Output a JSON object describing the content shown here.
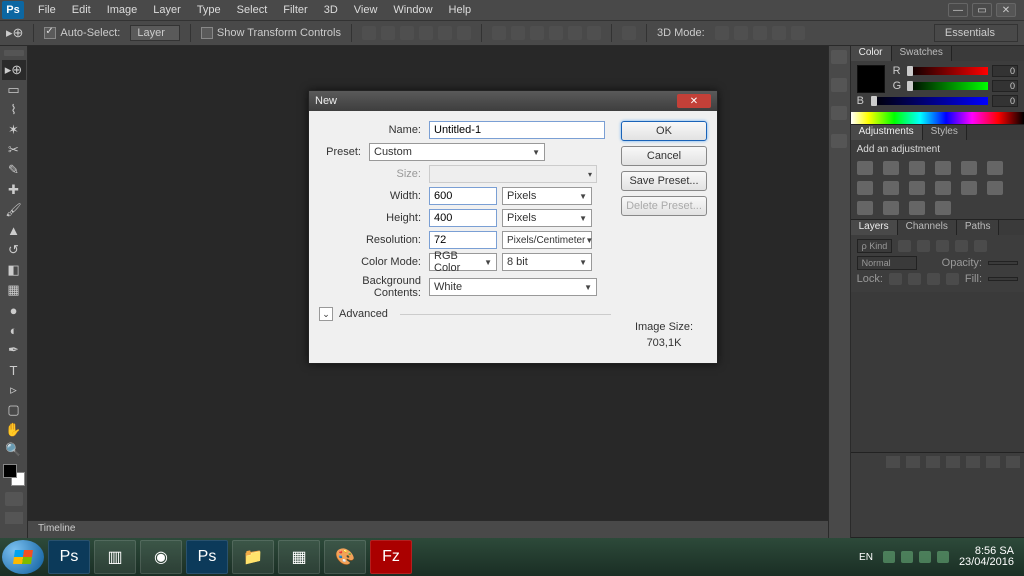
{
  "menubar": {
    "logo": "Ps",
    "items": [
      "File",
      "Edit",
      "Image",
      "Layer",
      "Type",
      "Select",
      "Filter",
      "3D",
      "View",
      "Window",
      "Help"
    ]
  },
  "optionsbar": {
    "auto_select": "Auto-Select:",
    "auto_select_target": "Layer",
    "show_transform": "Show Transform Controls",
    "mode_3d": "3D Mode:",
    "workspace": "Essentials"
  },
  "dialog": {
    "title": "New",
    "labels": {
      "name": "Name:",
      "preset": "Preset:",
      "size": "Size:",
      "width": "Width:",
      "height": "Height:",
      "resolution": "Resolution:",
      "color_mode": "Color Mode:",
      "bg_contents": "Background Contents:",
      "advanced": "Advanced",
      "image_size": "Image Size:"
    },
    "values": {
      "name": "Untitled-1",
      "preset": "Custom",
      "width": "600",
      "width_unit": "Pixels",
      "height": "400",
      "height_unit": "Pixels",
      "resolution": "72",
      "resolution_unit": "Pixels/Centimeter",
      "color_mode": "RGB Color",
      "bit_depth": "8 bit",
      "bg": "White",
      "image_size_value": "703,1K"
    },
    "buttons": {
      "ok": "OK",
      "cancel": "Cancel",
      "save_preset": "Save Preset...",
      "delete_preset": "Delete Preset..."
    }
  },
  "panels": {
    "color": {
      "tabs": [
        "Color",
        "Swatches"
      ],
      "r": "0",
      "g": "0",
      "b": "0"
    },
    "adjustments": {
      "tabs": [
        "Adjustments",
        "Styles"
      ],
      "title": "Add an adjustment"
    },
    "layers": {
      "tabs": [
        "Layers",
        "Channels",
        "Paths"
      ],
      "kind": "ρ Kind",
      "blend": "Normal",
      "opacity": "Opacity:",
      "lock": "Lock:",
      "fill": "Fill:"
    }
  },
  "timeline": {
    "label": "Timeline"
  },
  "taskbar": {
    "lang": "EN",
    "time": "8:56 SA",
    "date": "23/04/2016"
  }
}
